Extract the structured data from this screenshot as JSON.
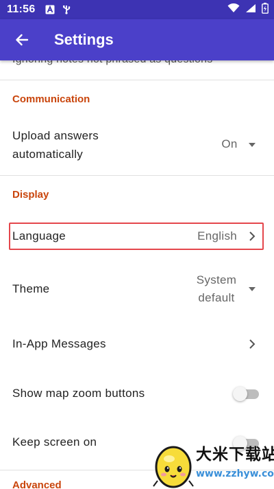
{
  "status_bar": {
    "time": "11:56",
    "icons": [
      "notification-a-icon",
      "usb-icon",
      "wifi-icon",
      "signal-icon",
      "battery-icon"
    ]
  },
  "app_bar": {
    "title": "Settings",
    "back_icon": "arrow-left-icon"
  },
  "content": {
    "cut_off_text": "Ignoring notes not phrased as questions",
    "sections": [
      {
        "header": "Communication",
        "items": [
          {
            "title": "Upload answers automatically",
            "value": "On",
            "control": "dropdown"
          }
        ]
      },
      {
        "header": "Display",
        "items": [
          {
            "title": "Language",
            "value": "English",
            "control": "chevron",
            "highlighted": true
          },
          {
            "title": "Theme",
            "value": "System default",
            "control": "dropdown"
          },
          {
            "title": "In-App Messages",
            "control": "chevron"
          },
          {
            "title": "Show map zoom buttons",
            "control": "switch",
            "checked": false
          },
          {
            "title": "Keep screen on",
            "control": "switch",
            "checked": false
          }
        ]
      },
      {
        "header": "Advanced",
        "items": []
      }
    ]
  },
  "watermark": {
    "line1": "大米下载站",
    "line2": "www.zzhyw.com"
  },
  "colors": {
    "status_bar": "#3d33b3",
    "app_bar": "#4b40c9",
    "section_header": "#c9450c",
    "highlight": "#e4464b",
    "watermark_url": "#3a8fd8"
  }
}
